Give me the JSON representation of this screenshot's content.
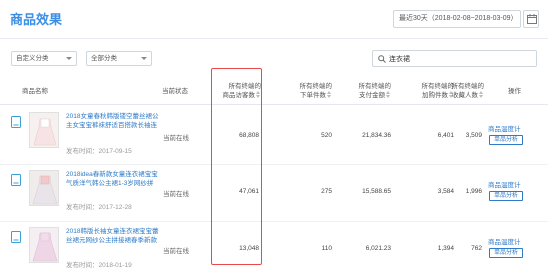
{
  "header": {
    "title": "商品效果",
    "date_range": "最近30天（2018-02-08~2018-03-09）"
  },
  "filters": {
    "custom_category": "自定义分类",
    "all_category": "全部分类",
    "search_value": "连衣裙",
    "search_icon": "search-icon"
  },
  "table": {
    "headers": {
      "name": "商品名称",
      "status": "当前状态",
      "visits_line1": "所有终端的",
      "visits_line2": "商品访客数",
      "buyers_line1": "所有终端的",
      "buyers_line2": "下单件数",
      "amount_line1": "所有终端的",
      "amount_line2": "支付金额",
      "cart_line1": "所有终端的",
      "cart_line2": "加购件数",
      "fav_line1": "所有终端的",
      "fav_line2": "收藏人数",
      "action": "操作"
    },
    "rows": [
      {
        "name": "2018女童春秋韩版镂空蕾丝裙公主女宝宝裤袜舒适百搭款长袖连",
        "time": "发布时间：2017-09-15",
        "status": "当前在线",
        "visitors": "68,808",
        "orders": "520",
        "amount": "21,834.36",
        "cart": "6,401",
        "fav": "3,509",
        "action1": "商品温度计",
        "action2": "单品分析"
      },
      {
        "name": "2018idea春新款女童连衣裙宝宝气质洋气韩公主裙1-3岁网纱拼",
        "time": "发布时间：2017-12-28",
        "status": "当前在线",
        "visitors": "47,061",
        "orders": "275",
        "amount": "15,588.65",
        "cart": "3,584",
        "fav": "1,996",
        "action1": "商品温度计",
        "action2": "单品分析"
      },
      {
        "name": "2018韩版长袖女童连衣裙宝宝蕾丝裙元网纱公主拼接裙春季新款",
        "time": "发布时间：2018-01-19",
        "status": "当前在线",
        "visitors": "13,048",
        "orders": "110",
        "amount": "6,021.23",
        "cart": "1,394",
        "fav": "762",
        "action1": "商品温度计",
        "action2": "单品分析"
      }
    ]
  },
  "colors": {
    "accent": "#3a8ee6",
    "link": "#2f7bc8",
    "highlight_box": "#e84a4a"
  }
}
